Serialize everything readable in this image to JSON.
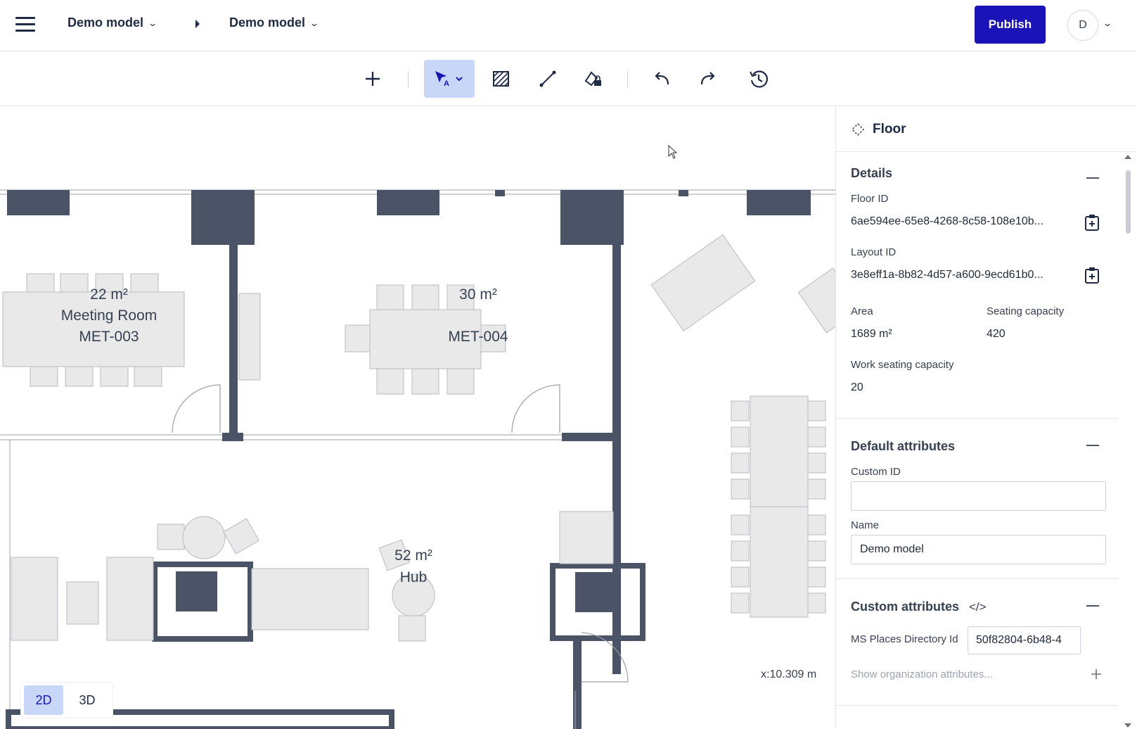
{
  "header": {
    "breadcrumb_1": "Demo model",
    "breadcrumb_2": "Demo model",
    "publish_label": "Publish",
    "avatar_initial": "D"
  },
  "canvas": {
    "rooms": [
      {
        "area": "22 m²",
        "name": "Meeting Room",
        "code": "MET-003"
      },
      {
        "area": "30 m²",
        "code": "MET-004"
      },
      {
        "area": "52 m²",
        "name": "Hub"
      }
    ],
    "coordinate_readout": "x:10.309 m",
    "view_2d": "2D",
    "view_3d": "3D"
  },
  "panel": {
    "title": "Floor",
    "details": {
      "title": "Details",
      "floor_id_label": "Floor ID",
      "floor_id": "6ae594ee-65e8-4268-8c58-108e10b...",
      "layout_id_label": "Layout ID",
      "layout_id": "3e8eff1a-8b82-4d57-a600-9ecd61b0...",
      "area_label": "Area",
      "area": "1689 m²",
      "seating_label": "Seating capacity",
      "seating": "420",
      "work_seating_label": "Work seating capacity",
      "work_seating": "20"
    },
    "default_attributes": {
      "title": "Default attributes",
      "custom_id_label": "Custom ID",
      "custom_id": "",
      "name_label": "Name",
      "name": "Demo model"
    },
    "custom_attributes": {
      "title": "Custom attributes",
      "code_icon": "</>",
      "ms_places_label": "MS Places Directory Id",
      "ms_places_value": "50f82804-6b48-4",
      "show_org_attrs": "Show organization attributes..."
    }
  },
  "colors": {
    "accent": "#1a13b8",
    "active_tool_bg": "#c8d7f7",
    "wall": "#4a5466",
    "furniture": "#e9e9ea"
  }
}
